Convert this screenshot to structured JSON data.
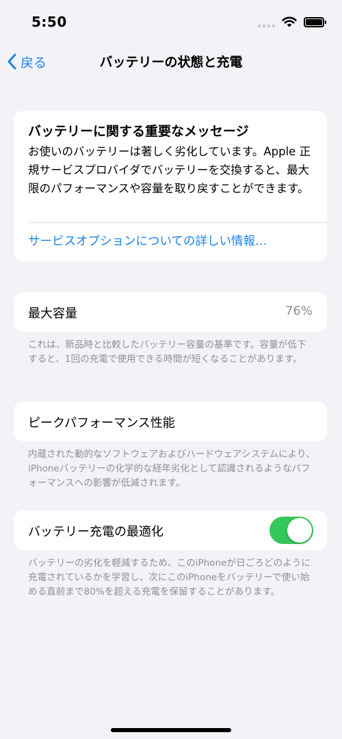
{
  "status_bar": {
    "time": "5:50"
  },
  "nav": {
    "back_label": "戻る",
    "title": "バッテリーの状態と充電"
  },
  "message": {
    "title": "バッテリーに関する重要なメッセージ",
    "body": "お使いのバッテリーは著しく劣化しています。Apple 正規サービスプロバイダでバッテリーを交換すると、最大限のパフォーマンスや容量を取り戻すことができます。",
    "link": "サービスオプションについての詳しい情報…"
  },
  "max_capacity": {
    "label": "最大容量",
    "value": "76%",
    "footer": "これは、新品時と比較したバッテリー容量の基準です。容量が低下すると、1回の充電で使用できる時間が短くなることがあります。"
  },
  "peak_performance": {
    "label": "ピークパフォーマンス性能",
    "footer": "内蔵された動的なソフトウェアおよびハードウェアシステムにより、iPhoneバッテリーの化学的な経年劣化として認識されるようなパフォーマンスへの影響が低減されます。"
  },
  "optimized_charging": {
    "label": "バッテリー充電の最適化",
    "enabled": true,
    "footer": "バッテリーの劣化を軽減するため、このiPhoneが日ごろどのように充電されているかを学習し、次にこのiPhoneをバッテリーで使い始める直前まで80%を超える充電を保留することがあります。"
  },
  "colors": {
    "accent": "#1a82e8",
    "toggle_on": "#34c759",
    "background": "#f2f2f7"
  },
  "icons": {
    "back": "chevron-left-icon",
    "wifi": "wifi-icon",
    "battery": "battery-icon",
    "signal": "cellular-signal-icon"
  }
}
